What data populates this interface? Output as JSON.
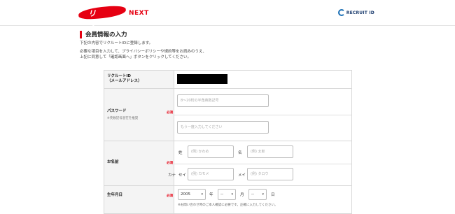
{
  "header": {
    "logo_main": "リクナビ",
    "logo_sub": "NEXT",
    "rid_label": "RECRUIT ID"
  },
  "page_title": "会員情報の入力",
  "intro": {
    "line1": "下記の内容でリクルートIDに登録します。",
    "line2": "必要な項目を入力して、プライバシーポリシーや規約等をお読みのうえ、",
    "line3": "上記に同意して「確認画面へ」ボタンをクリックしてください。"
  },
  "form": {
    "recruit_id": {
      "label_line1": "リクルートID",
      "label_line2": "（メールアドレス）"
    },
    "password": {
      "label": "パスワード",
      "sub": "※英数記号混在を推奨",
      "required": "必須",
      "placeholder1": "8〜20桁の半角英数記号",
      "placeholder2": "もう一度入力してください"
    },
    "name": {
      "label": "お名前",
      "required": "必須",
      "sei_label": "姓",
      "mei_label": "名",
      "sei_placeholder": "(例) かわめ",
      "mei_placeholder": "(例) 太郎",
      "kana_label": "カナ",
      "sei_kana_label": "セイ",
      "mei_kana_label": "メイ",
      "sei_kana_placeholder": "(例) カモメ",
      "mei_kana_placeholder": "(例) タロウ"
    },
    "birthday": {
      "label": "生年月日",
      "required": "必須",
      "year_value": "2005",
      "year_unit": "年",
      "month_value": "--",
      "month_unit": "月",
      "day_value": "--",
      "day_unit": "日",
      "note": "※お間い合わせ時のご本人確認に必要です。正確に入力してください。"
    }
  },
  "icons": {
    "dropdown": "chevron-down-icon"
  }
}
